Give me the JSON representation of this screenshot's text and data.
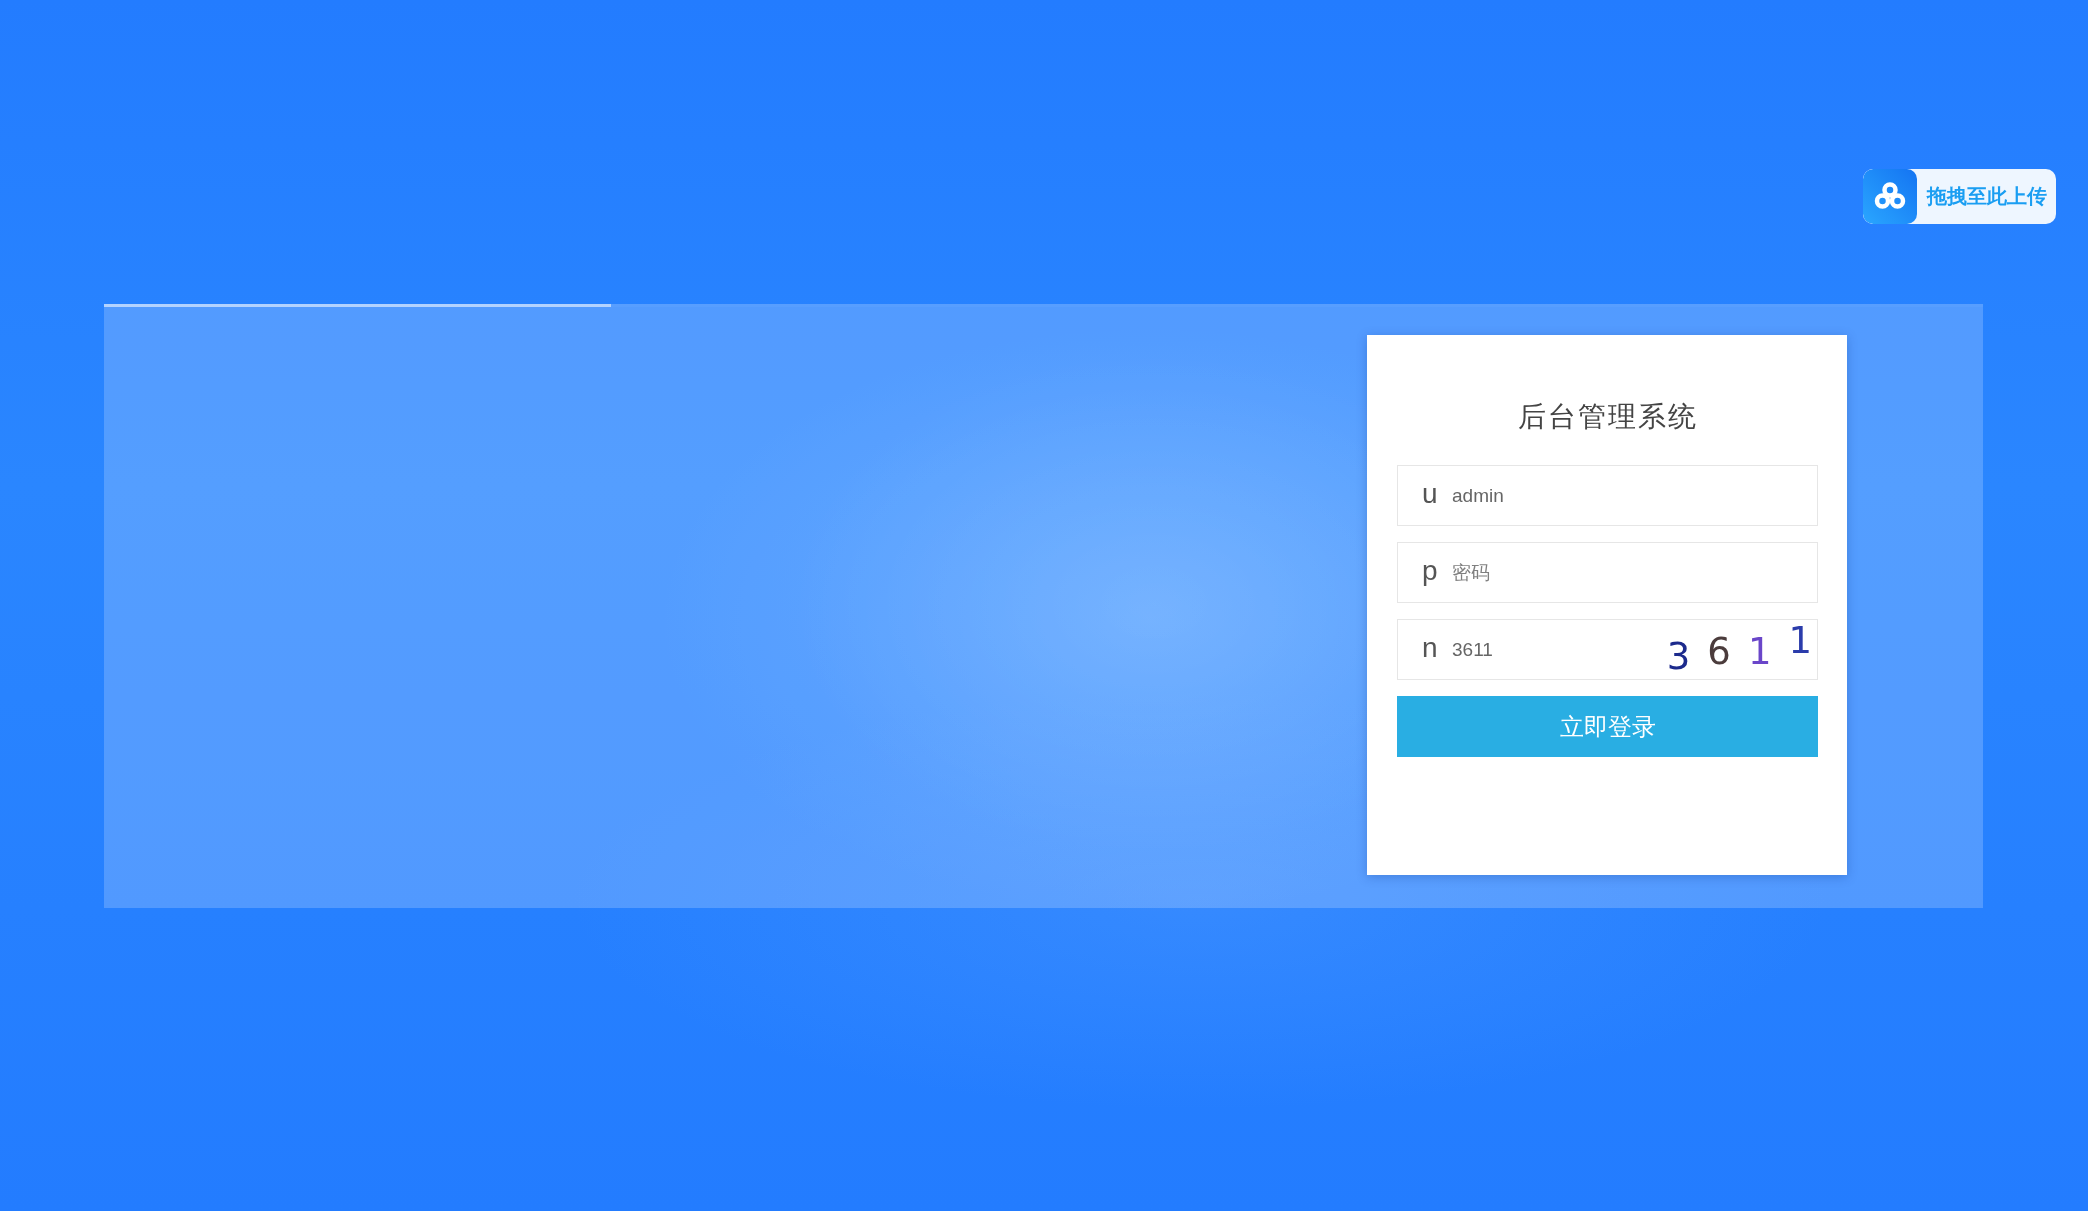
{
  "upload_button": {
    "label": "拖拽至此上传"
  },
  "slider": {
    "level": 0.27
  },
  "login": {
    "title": "后台管理系统",
    "fields": [
      {
        "kind": "text",
        "prefix": "u",
        "value": "admin"
      },
      {
        "kind": "password",
        "prefix": "p",
        "placeholder": "密码"
      },
      {
        "kind": "captcha",
        "prefix": "n",
        "value": "3611",
        "captcha": [
          "3",
          "6",
          "1",
          "1"
        ]
      }
    ],
    "submit": "立即登录"
  }
}
